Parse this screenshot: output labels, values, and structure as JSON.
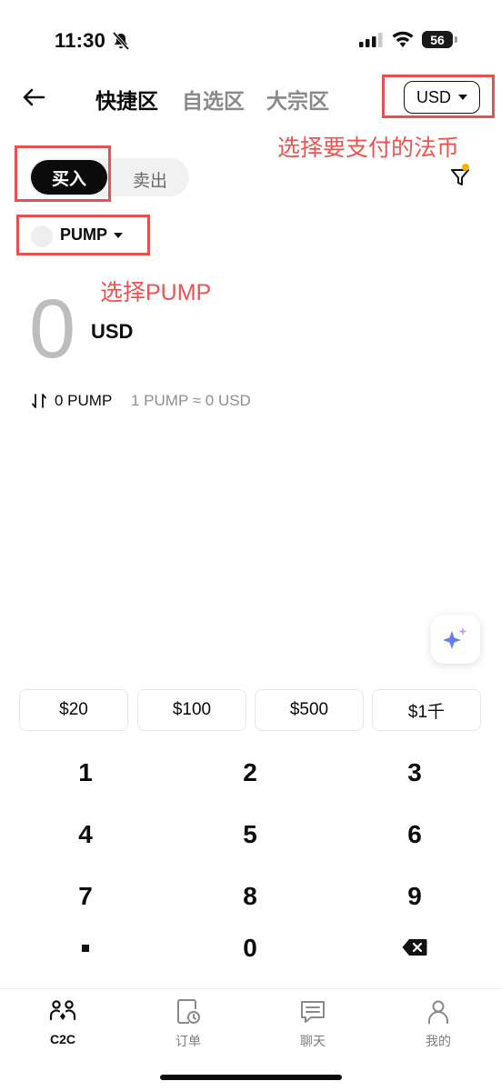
{
  "status_bar": {
    "time": "11:30",
    "battery": "56"
  },
  "nav": {
    "tabs": [
      {
        "label": "快捷区",
        "active": true
      },
      {
        "label": "自选区",
        "active": false
      },
      {
        "label": "大宗区",
        "active": false
      }
    ],
    "currency": "USD"
  },
  "annotations": {
    "currency_hint": "选择要支付的法币",
    "coin_hint": "选择PUMP"
  },
  "trade_toggle": {
    "buy": "买入",
    "sell": "卖出",
    "selected": "buy"
  },
  "coin_selector": {
    "symbol": "PUMP"
  },
  "amount": {
    "value": "0",
    "unit": "USD"
  },
  "conversion": {
    "amount": "0 PUMP",
    "rate": "1 PUMP ≈ 0 USD"
  },
  "quick_amounts": [
    "$20",
    "$100",
    "$500",
    "$1千"
  ],
  "keypad": {
    "digits": [
      "1",
      "2",
      "3",
      "4",
      "5",
      "6",
      "7",
      "8",
      "9",
      "0"
    ]
  },
  "bottom_tabs": [
    {
      "label": "C2C",
      "icon": "c2c-users-icon",
      "active": true
    },
    {
      "label": "订单",
      "icon": "order-clock-icon",
      "active": false
    },
    {
      "label": "聊天",
      "icon": "chat-icon",
      "active": false
    },
    {
      "label": "我的",
      "icon": "profile-icon",
      "active": false
    }
  ],
  "colors": {
    "accent_annotation": "#e8514f",
    "filter_dot": "#f5b400",
    "primary": "#0b0b0b"
  }
}
